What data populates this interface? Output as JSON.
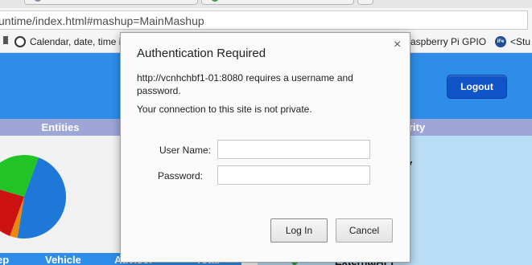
{
  "browser": {
    "url": "untime/index.html#mashup=MainMashup"
  },
  "bookmarks": [
    {
      "label": "Calendar, date, time i",
      "icon": "calendar-icon"
    },
    {
      "label": "aspberry Pi GPIO",
      "icon": "raspberry-pi-icon"
    },
    {
      "label": "<Stu",
      "icon": "bookmark-icon"
    }
  ],
  "app": {
    "logout_label": "Logout",
    "entities_title": "Entities",
    "activity_title": "rity",
    "activity_subtitle": "ity",
    "table_headers": [
      "ер",
      "Vehicle",
      "Advisor",
      "Total"
    ],
    "external_api": "ExternalAPI"
  },
  "chart_data": {
    "type": "pie",
    "title": "",
    "slices": [
      {
        "label": "",
        "share": 0.47,
        "color": "#1f78d8"
      },
      {
        "label": "",
        "share": 0.03,
        "color": "#e8880f"
      },
      {
        "label": "",
        "share": 0.24,
        "color": "#cc1111"
      },
      {
        "label": "",
        "share": 0.26,
        "color": "#22c425"
      }
    ]
  },
  "dialog": {
    "title": "Authentication Required",
    "message": "http://vcnhchbf1-01:8080 requires a username and password.",
    "warning": "Your connection to this site is not private.",
    "username_label": "User Name:",
    "username_value": "",
    "password_label": "Password:",
    "password_value": "",
    "login_label": "Log In",
    "cancel_label": "Cancel",
    "close_glyph": "×"
  },
  "colors": {
    "header_blue": "#2e8de8",
    "panel_title": "#9da6d6",
    "logout_button": "#0f55c9",
    "activity_bg": "#b9ddf4"
  }
}
